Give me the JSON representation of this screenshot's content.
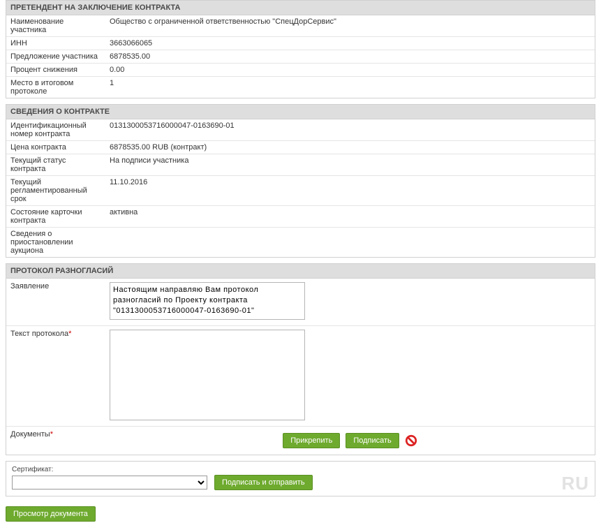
{
  "applicant": {
    "header": "ПРЕТЕНДЕНТ НА ЗАКЛЮЧЕНИЕ КОНТРАКТА",
    "name_label": "Наименование участника",
    "name_value": "Общество с ограниченной ответственностью \"СпецДорСервис\"",
    "inn_label": "ИНН",
    "inn_value": "3663066065",
    "offer_label": "Предложение участника",
    "offer_value": "6878535.00",
    "reduction_label": "Процент снижения",
    "reduction_value": "0.00",
    "rank_label": "Место в итоговом протоколе",
    "rank_value": "1"
  },
  "contract": {
    "header": "СВЕДЕНИЯ О КОНТРАКТЕ",
    "id_label": "Идентификационный номер контракта",
    "id_value": "0131300053716000047-0163690-01",
    "price_label": "Цена контракта",
    "price_value": "6878535.00  RUB  (контракт)",
    "status_label": "Текущий статус контракта",
    "status_value": "На подписи участника",
    "deadline_label": "Текущий регламентированный срок",
    "deadline_value": "11.10.2016",
    "card_state_label": "Состояние карточки контракта",
    "card_state_value": "активна",
    "suspension_label": "Сведения о приостановлении аукциона",
    "suspension_value": ""
  },
  "protocol": {
    "header": "ПРОТОКОЛ РАЗНОГЛАСИЙ",
    "statement_label": "Заявление",
    "statement_value": "Настоящим направляю Вам протокол разногласий по Проекту контракта \"0131300053716000047-0163690-01\"",
    "text_label": "Текст протокола",
    "text_value": "",
    "docs_label": "Документы",
    "attach_btn": "Прикрепить",
    "sign_btn": "Подписать"
  },
  "cert": {
    "label": "Сертификат:",
    "selected": "",
    "sign_send_btn": "Подписать и отправить",
    "ru": "RU"
  },
  "actions": {
    "preview_btn": "Просмотр документа"
  }
}
